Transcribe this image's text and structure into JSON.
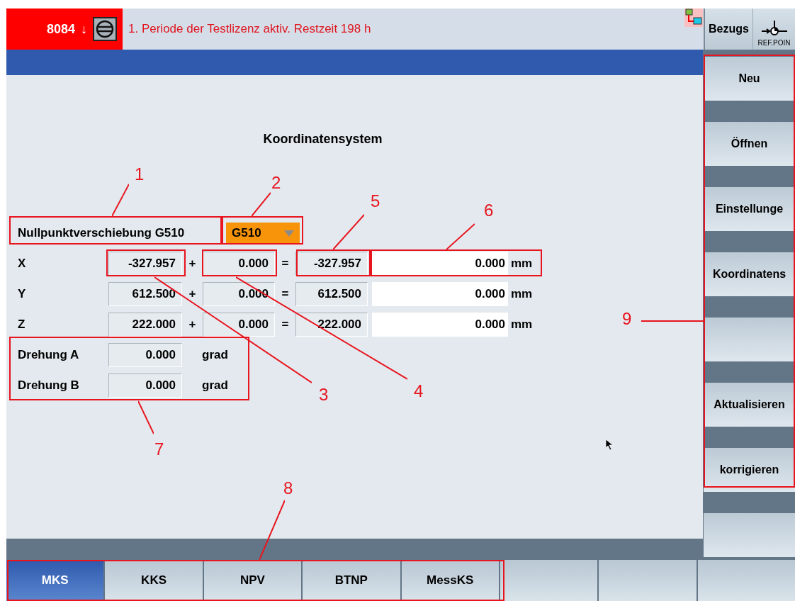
{
  "header": {
    "alarm_number": "8084",
    "alarm_arrow": "↓",
    "message": "1. Periode der Testlizenz aktiv. Restzeit 198 h"
  },
  "top_buttons": [
    {
      "kind": "text",
      "label": "Bezugs"
    },
    {
      "kind": "refpoint",
      "label": "REF.POIN"
    }
  ],
  "title": "Koordinatensystem",
  "offset": {
    "label": "Nullpunktverschiebung G510",
    "value": "G510"
  },
  "axes": [
    {
      "name": "X",
      "base": "-327.957",
      "plus": "+",
      "shift": "0.000",
      "equals": "=",
      "result": "-327.957",
      "value": "0.000",
      "unit": "mm"
    },
    {
      "name": "Y",
      "base": "612.500",
      "plus": "+",
      "shift": "0.000",
      "equals": "=",
      "result": "612.500",
      "value": "0.000",
      "unit": "mm"
    },
    {
      "name": "Z",
      "base": "222.000",
      "plus": "+",
      "shift": "0.000",
      "equals": "=",
      "result": "222.000",
      "value": "0.000",
      "unit": "mm"
    }
  ],
  "rotations": [
    {
      "label": "Drehung A",
      "value": "0.000",
      "unit": "grad"
    },
    {
      "label": "Drehung B",
      "value": "0.000",
      "unit": "grad"
    }
  ],
  "softkeys": [
    {
      "kind": "text",
      "label": "Neu"
    },
    {
      "kind": "text",
      "label": "Öffnen"
    },
    {
      "kind": "text",
      "label": "Einstellunge"
    },
    {
      "kind": "text",
      "label": "Koordinatens"
    },
    {
      "kind": "blank"
    },
    {
      "kind": "text",
      "label": "Aktualisieren"
    },
    {
      "kind": "text",
      "label": "korrigieren"
    },
    {
      "kind": "blank"
    }
  ],
  "tabs": [
    {
      "kind": "text",
      "label": "MKS",
      "selected": true
    },
    {
      "kind": "text",
      "label": "KKS",
      "selected": false
    },
    {
      "kind": "text",
      "label": "NPV",
      "selected": false
    },
    {
      "kind": "text",
      "label": "BTNP",
      "selected": false
    },
    {
      "kind": "text",
      "label": "MessKS",
      "selected": false
    },
    {
      "kind": "blank",
      "selected": false
    },
    {
      "kind": "blank",
      "selected": false
    },
    {
      "kind": "blank",
      "selected": false
    }
  ],
  "annotations": [
    "1",
    "2",
    "3",
    "4",
    "5",
    "6",
    "7",
    "8",
    "9"
  ]
}
